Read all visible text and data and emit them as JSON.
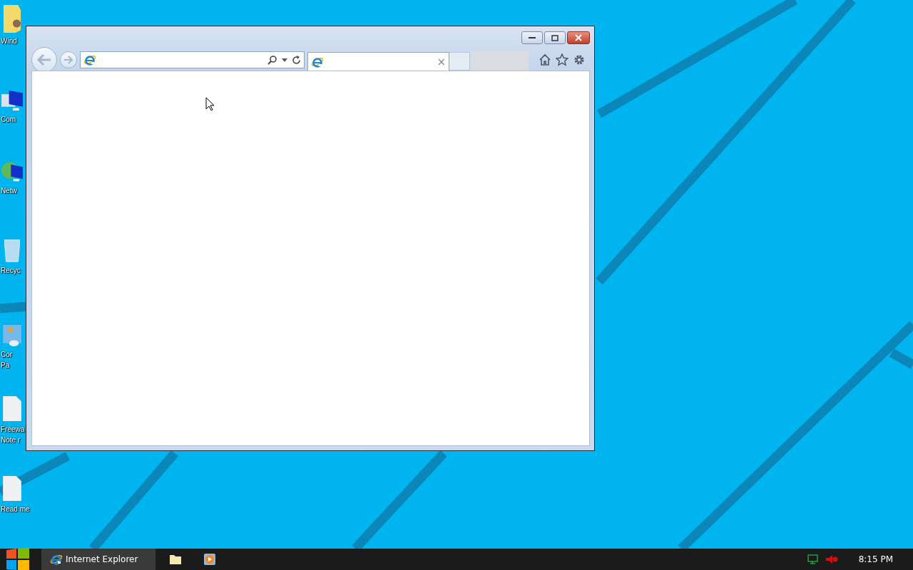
{
  "desktop": {
    "icons": [
      {
        "kind": "folder",
        "lines": [
          "Wind"
        ]
      },
      {
        "kind": "computer",
        "lines": [
          "Com"
        ]
      },
      {
        "kind": "network",
        "lines": [
          "Netw"
        ]
      },
      {
        "kind": "recycle",
        "lines": [
          "Recyc"
        ]
      },
      {
        "kind": "control",
        "lines": [
          "Cor",
          "Pa"
        ]
      },
      {
        "kind": "document",
        "lines": [
          "Freewa",
          "Note r"
        ]
      },
      {
        "kind": "document",
        "lines": [
          "Read me"
        ]
      }
    ]
  },
  "browser": {
    "tabs": [
      {
        "close": "×",
        "selected": true
      }
    ]
  },
  "taskbar": {
    "items": [
      {
        "kind": "ie",
        "label": "Internet Explorer",
        "selected": true
      },
      {
        "kind": "folder",
        "selected": false
      },
      {
        "kind": "media",
        "selected": false
      }
    ],
    "clock": "8:15 PM"
  }
}
